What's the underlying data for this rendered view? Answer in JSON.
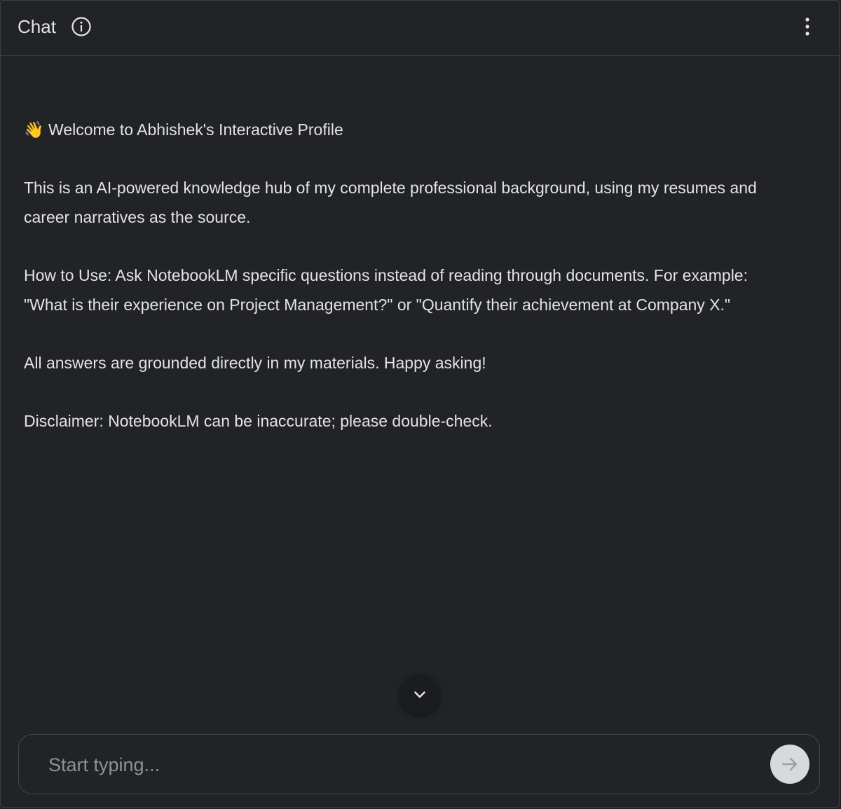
{
  "header": {
    "title": "Chat",
    "info_icon": "info-icon",
    "menu_icon": "more-vert-icon"
  },
  "messages": [
    "👋 Welcome to Abhishek's Interactive Profile",
    "This is an AI-powered knowledge hub of my complete professional background, using my resumes and career narratives as the source.",
    "How to Use: Ask NotebookLM specific questions instead of reading through documents. For example: \"What is their experience on Project Management?\" or \"Quantify their achievement at Company X.\"",
    "All answers are grounded directly in my materials. Happy asking!",
    "Disclaimer: NotebookLM can be inaccurate; please double-check."
  ],
  "scroll_down_icon": "chevron-down-icon",
  "composer": {
    "placeholder": "Start typing...",
    "value": "",
    "send_icon": "arrow-right-icon"
  },
  "colors": {
    "background": "#212327",
    "border": "#3c4043",
    "text": "#e3e3e3",
    "placeholder": "#8e9196",
    "send_button": "#d7d9dc"
  }
}
